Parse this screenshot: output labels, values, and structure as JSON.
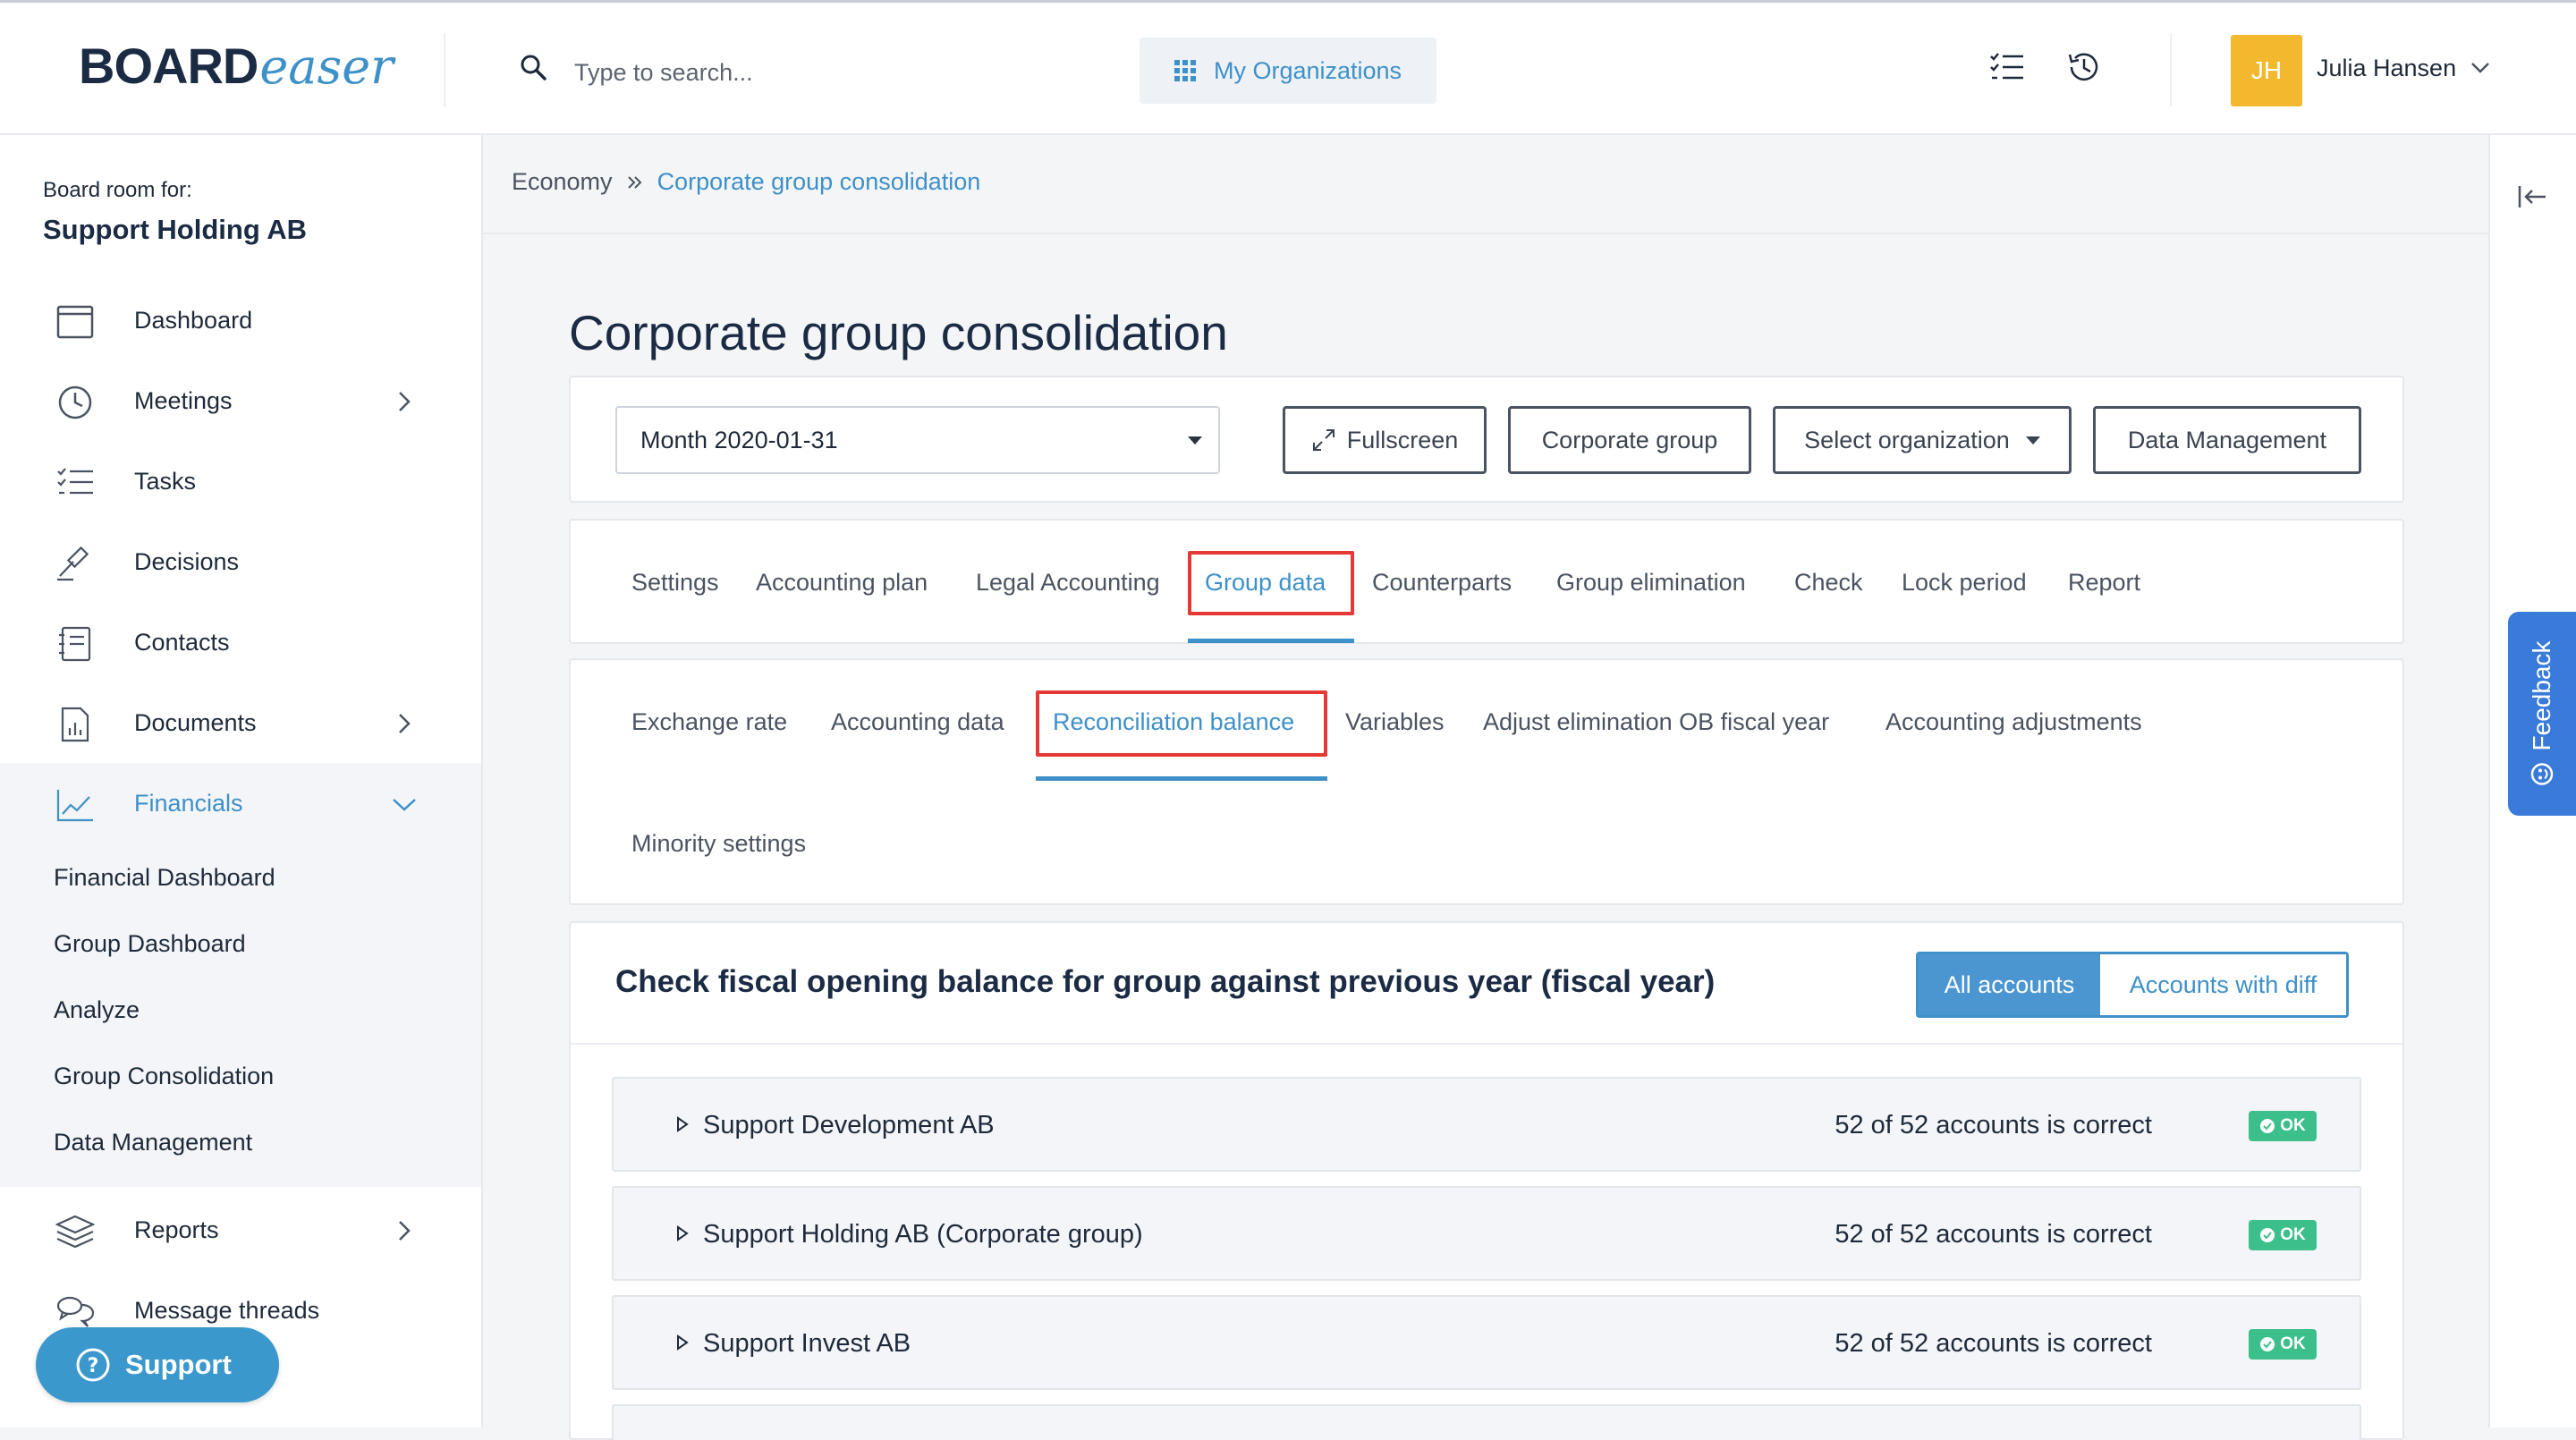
{
  "header": {
    "logo_board": "BOARD",
    "logo_easer": "easer",
    "search_placeholder": "Type to search...",
    "my_orgs_label": "My Organizations",
    "user_initials": "JH",
    "user_name": "Julia Hansen"
  },
  "sidebar": {
    "board_for_label": "Board room for:",
    "board_name": "Support Holding AB",
    "items": [
      {
        "label": "Dashboard",
        "icon": "calendar-window-icon"
      },
      {
        "label": "Meetings",
        "icon": "clock-icon"
      },
      {
        "label": "Tasks",
        "icon": "checklist-icon"
      },
      {
        "label": "Decisions",
        "icon": "gavel-icon"
      },
      {
        "label": "Contacts",
        "icon": "address-book-icon"
      },
      {
        "label": "Documents",
        "icon": "document-chart-icon"
      },
      {
        "label": "Financials",
        "icon": "line-chart-icon"
      },
      {
        "label": "Reports",
        "icon": "layers-icon"
      },
      {
        "label": "Message threads",
        "icon": "chat-bubbles-icon"
      }
    ],
    "financials_sub": [
      "Financial Dashboard",
      "Group Dashboard",
      "Analyze",
      "Group Consolidation",
      "Data Management"
    ],
    "support_label": "Support"
  },
  "feedback_label": "Feedback",
  "breadcrumb": {
    "parent": "Economy",
    "current": "Corporate group consolidation"
  },
  "page_title": "Corporate group consolidation",
  "toolbar": {
    "month_value": "Month 2020-01-31",
    "fullscreen": "Fullscreen",
    "corporate_group": "Corporate group",
    "select_org": "Select organization",
    "data_management": "Data Management"
  },
  "main_tabs": [
    "Settings",
    "Accounting plan",
    "Legal Accounting",
    "Group data",
    "Counterparts",
    "Group elimination",
    "Check",
    "Lock period",
    "Report"
  ],
  "main_tab_selected": "Group data",
  "sub_tabs": [
    "Exchange rate",
    "Accounting data",
    "Reconciliation balance",
    "Variables",
    "Adjust elimination OB fiscal year",
    "Accounting adjustments",
    "Minority settings"
  ],
  "sub_tab_selected": "Reconciliation balance",
  "section": {
    "title": "Check fiscal opening balance for group against previous year (fiscal year)",
    "filter_all": "All accounts",
    "filter_diff": "Accounts with diff"
  },
  "accounts": [
    {
      "name": "Support Development AB",
      "status": "52 of 52 accounts is correct",
      "badge": "OK"
    },
    {
      "name": "Support Holding AB (Corporate group)",
      "status": "52 of 52 accounts is correct",
      "badge": "OK"
    },
    {
      "name": "Support Invest AB",
      "status": "52 of 52 accounts is correct",
      "badge": "OK"
    }
  ],
  "colors": {
    "accent": "#3e90c8",
    "highlight_box": "#e53935",
    "ok_green": "#3cbf8a",
    "avatar": "#f2b92e",
    "feedback": "#3a7ad9"
  }
}
